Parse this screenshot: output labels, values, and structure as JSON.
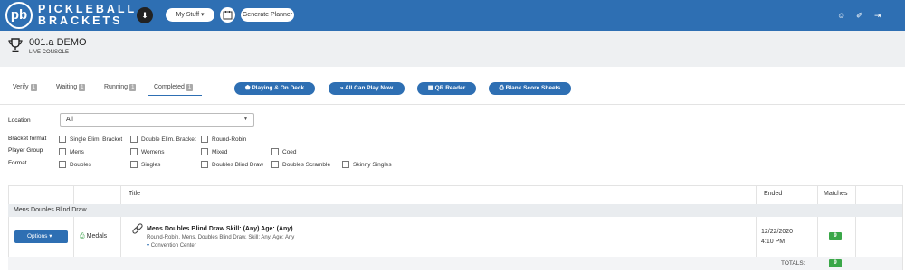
{
  "header": {
    "logo_mark": "pb",
    "logo_line1": "PICKLEBALL",
    "logo_line2": "BRACKETS",
    "my_stuff": "My Stuff ▾",
    "generate_planner": "Generate Planner",
    "brand_color": "#2e6fb3",
    "icons": [
      "chevron-down-icon",
      "calendar-icon",
      "user-icon",
      "key-icon",
      "logout-icon"
    ]
  },
  "console": {
    "title": "001.a DEMO",
    "subtitle": "LIVE CONSOLE"
  },
  "tabs": [
    {
      "label": "Verify",
      "count": "1"
    },
    {
      "label": "Waiting",
      "count": "1"
    },
    {
      "label": "Running",
      "count": "1"
    },
    {
      "label": "Completed",
      "count": "1",
      "active": true
    }
  ],
  "actions": {
    "playing": "Playing & On Deck",
    "all_can_play": "All Can Play Now",
    "qr_reader": "QR Reader",
    "blank_sheets": "Blank Score Sheets"
  },
  "filters": {
    "location_label": "Location",
    "location_value": "All",
    "bracket_format_label": "Bracket format",
    "bracket_format_options": [
      "Single Elim. Bracket",
      "Double Elim. Bracket",
      "Round-Robin"
    ],
    "player_group_label": "Player Group",
    "player_group_options": [
      "Mens",
      "Womens",
      "Mixed",
      "Coed"
    ],
    "format_label": "Format",
    "format_options": [
      "Doubles",
      "Singles",
      "Doubles Blind Draw",
      "Doubles Scramble",
      "Skinny Singles"
    ]
  },
  "table": {
    "headers": {
      "title": "Title",
      "ended": "Ended",
      "matches": "Matches"
    },
    "group": "Mens Doubles Blind Draw",
    "row": {
      "options": "Options ▾",
      "medals": "Medals",
      "title": "Mens Doubles Blind Draw Skill: (Any) Age: (Any)",
      "description": "Round-Robin, Mens, Doubles Blind Draw, Skill: Any, Age: Any",
      "location": "Convention Center",
      "ended_date": "12/22/2020",
      "ended_time": "4:10 PM",
      "matches": "9"
    },
    "totals_label": "TOTALS:",
    "totals_matches": "9"
  }
}
